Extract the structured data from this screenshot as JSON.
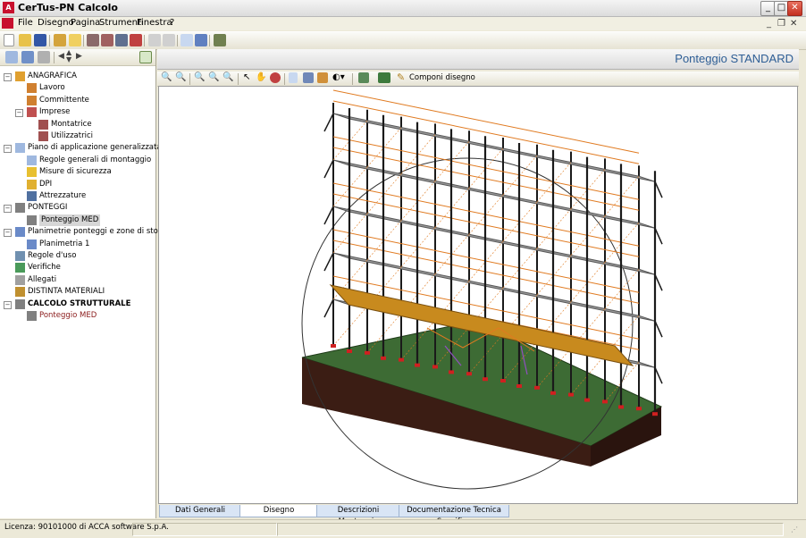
{
  "window": {
    "title": "CerTus-PN Calcolo"
  },
  "menu": [
    "File",
    "Disegno",
    "Pagina",
    "Strumenti",
    "Finestra",
    "?"
  ],
  "tree": [
    {
      "label": "ANAGRAFICA",
      "level": 0,
      "icon": "folder-icon"
    },
    {
      "label": "Lavoro",
      "level": 1,
      "icon": "person-icon"
    },
    {
      "label": "Committente",
      "level": 1,
      "icon": "person-icon"
    },
    {
      "label": "Imprese",
      "level": 1,
      "icon": "people-icon"
    },
    {
      "label": "Montatrice",
      "level": 2,
      "icon": "building-icon"
    },
    {
      "label": "Utilizzatrici",
      "level": 2,
      "icon": "building-icon"
    },
    {
      "label": "Piano di applicazione generalizzata",
      "level": 0,
      "icon": "document-icon"
    },
    {
      "label": "Regole generali di montaggio",
      "level": 1,
      "icon": "document-icon"
    },
    {
      "label": "Misure di sicurezza",
      "level": 1,
      "icon": "warning-icon"
    },
    {
      "label": "DPI",
      "level": 1,
      "icon": "helmet-icon"
    },
    {
      "label": "Attrezzature",
      "level": 1,
      "icon": "wrench-icon"
    },
    {
      "label": "PONTEGGI",
      "level": 0,
      "icon": "scaffold-icon"
    },
    {
      "label": "Ponteggio MED",
      "level": 1,
      "icon": "scaffold-icon"
    },
    {
      "label": "Planimetrie ponteggi e zone di stoccaggio",
      "level": 0,
      "icon": "plan-icon"
    },
    {
      "label": "Planimetria 1",
      "level": 1,
      "icon": "plan-icon"
    },
    {
      "label": "Regole d'uso",
      "level": 0,
      "icon": "gear-icon"
    },
    {
      "label": "Verifiche",
      "level": 0,
      "icon": "check-icon"
    },
    {
      "label": "Allegati",
      "level": 0,
      "icon": "paperclip-icon"
    },
    {
      "label": "DISTINTA MATERIALI",
      "level": 0,
      "icon": "materials-icon"
    },
    {
      "label": "CALCOLO STRUTTURALE",
      "level": 0,
      "icon": "scaffold-icon"
    },
    {
      "label": "Ponteggio MED",
      "level": 1,
      "icon": "scaffold-icon"
    }
  ],
  "page_title": "Ponteggio STANDARD",
  "view_toolbar": {
    "compose_label": "Componi disegno"
  },
  "tabs": [
    "Dati Generali",
    "Disegno",
    "Descrizioni Montaggio",
    "Documentazione Tecnica Specifica"
  ],
  "active_tab": "Disegno",
  "status": {
    "license": "Licenza: 90101000 di ACCA software S.p.A."
  },
  "colors": {
    "accent_title": "#2e5e95",
    "deck": "#c88a1e",
    "ground_top": "#3d6b34",
    "ground_side": "#3b1d14",
    "frame": "#1a1a1a",
    "brace": "#e07a20"
  }
}
